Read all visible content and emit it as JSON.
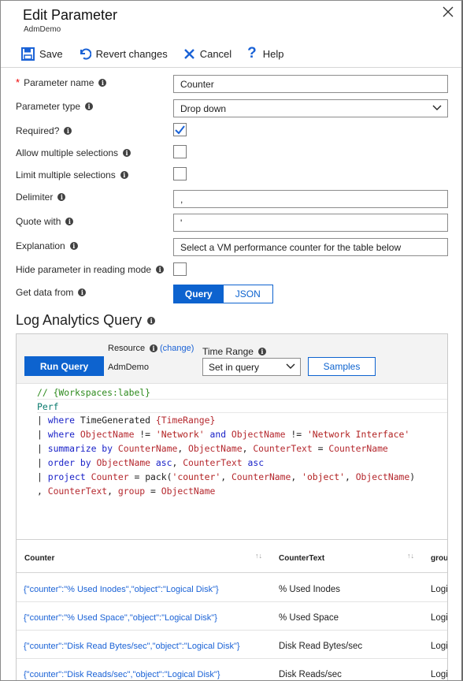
{
  "header": {
    "title": "Edit Parameter",
    "subtitle": "AdmDemo"
  },
  "toolbar": {
    "save_label": "Save",
    "revert_label": "Revert changes",
    "cancel_label": "Cancel",
    "help_label": "Help"
  },
  "form": {
    "parameter_name": {
      "label": "Parameter name",
      "value": "Counter"
    },
    "parameter_type": {
      "label": "Parameter type",
      "value": "Drop down"
    },
    "required": {
      "label": "Required?",
      "checked": true
    },
    "allow_multiple": {
      "label": "Allow multiple selections",
      "checked": false
    },
    "limit_multiple": {
      "label": "Limit multiple selections",
      "checked": false
    },
    "delimiter": {
      "label": "Delimiter",
      "value": ","
    },
    "quote_with": {
      "label": "Quote with",
      "value": "'"
    },
    "explanation": {
      "label": "Explanation",
      "value": "Select a VM performance counter for the table below"
    },
    "hide_param": {
      "label": "Hide parameter in reading mode",
      "checked": false
    },
    "get_data_from": {
      "label": "Get data from",
      "options": [
        "Query",
        "JSON"
      ],
      "selected": "Query"
    }
  },
  "query_section": {
    "title": "Log Analytics Query",
    "run_query_label": "Run Query",
    "resource_label": "Resource",
    "resource_change": "(change)",
    "resource_value": "AdmDemo",
    "time_range_label": "Time Range",
    "time_range_value": "Set in query",
    "samples_label": "Samples"
  },
  "code": {
    "line1": "// {Workspaces:label}",
    "line2": "Perf",
    "l3_pipe": "| ",
    "l3_kw": "where",
    "l3_a": " TimeGenerated ",
    "l3_b": "{TimeRange}",
    "l4_pipe": "| ",
    "l4_kw": "where",
    "l4_a": " ObjectName",
    "l4_op1": " != ",
    "l4_s1": "'Network'",
    "l4_and": " and ",
    "l4_b": "ObjectName",
    "l4_op2": " != ",
    "l4_s2": "'Network Interface'",
    "l5_pipe": "| ",
    "l5_kw": "summarize by",
    "l5_a": " CounterName",
    "l5_c1": ", ",
    "l5_b": "ObjectName",
    "l5_c2": ", ",
    "l5_c": "CounterText",
    "l5_eq": " = ",
    "l5_d": "CounterName",
    "l6_pipe": "| ",
    "l6_kw": "order by",
    "l6_a": " ObjectName",
    "l6_asc1": " asc",
    "l6_c1": ", ",
    "l6_b": "CounterText",
    "l6_asc2": " asc",
    "l7_pipe": "| ",
    "l7_kw": "project",
    "l7_a": " Counter",
    "l7_eq": " = ",
    "l7_fn": "pack(",
    "l7_s1": "'counter'",
    "l7_c1": ", ",
    "l7_b": "CounterName",
    "l7_c2": ", ",
    "l7_s2": "'object'",
    "l7_c3": ", ",
    "l7_c": "ObjectName",
    "l7_close": ")",
    "l8_c0": ", ",
    "l8_a": "CounterText",
    "l8_c1": ", ",
    "l8_b": "group",
    "l8_eq": " = ",
    "l8_c": "ObjectName"
  },
  "results": {
    "columns": [
      "Counter",
      "CounterText",
      "grou"
    ],
    "sort_glyph": "↑↓",
    "rows": [
      {
        "counter": "{\"counter\":\"% Used Inodes\",\"object\":\"Logical Disk\"}",
        "text": "% Used Inodes",
        "group": "Logi"
      },
      {
        "counter": "{\"counter\":\"% Used Space\",\"object\":\"Logical Disk\"}",
        "text": "% Used Space",
        "group": "Logi"
      },
      {
        "counter": "{\"counter\":\"Disk Read Bytes/sec\",\"object\":\"Logical Disk\"}",
        "text": "Disk Read Bytes/sec",
        "group": "Logi"
      },
      {
        "counter": "{\"counter\":\"Disk Reads/sec\",\"object\":\"Logical Disk\"}",
        "text": "Disk Reads/sec",
        "group": "Logi"
      }
    ]
  },
  "colors": {
    "accent": "#0d63cf",
    "link": "#1a62d6",
    "required_star": "#ee0000"
  },
  "icons": {
    "save": "floppy-disk-icon",
    "revert": "undo-icon",
    "cancel": "x-icon",
    "help": "question-mark-icon",
    "close": "close-icon",
    "info": "info-icon"
  }
}
